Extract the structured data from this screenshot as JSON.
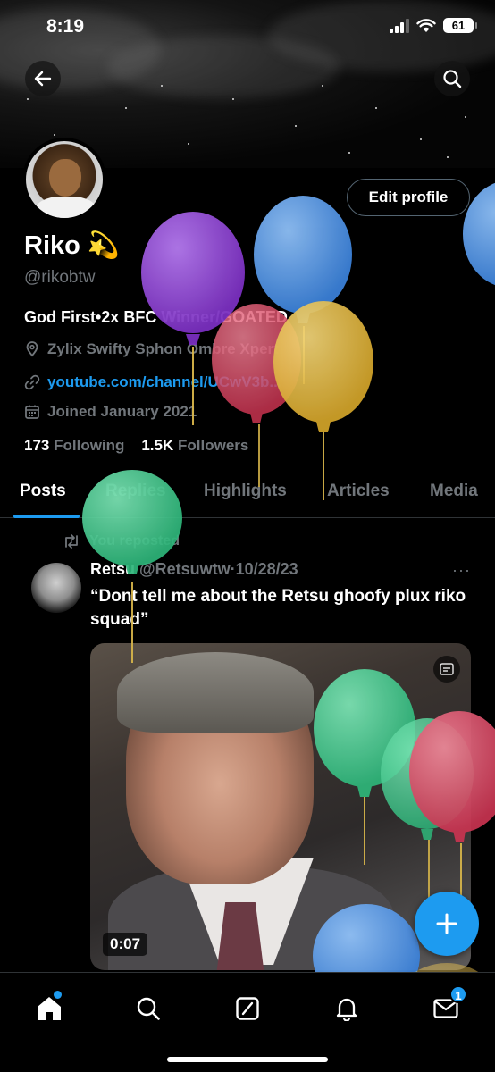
{
  "status_bar": {
    "time": "8:19",
    "battery": "61"
  },
  "header": {
    "back_icon": "arrow-left-icon",
    "search_icon": "search-icon"
  },
  "profile": {
    "name": "Riko",
    "emoji": "💫",
    "handle": "@rikobtw",
    "edit_label": "Edit profile",
    "bio": "God First•2x BFC Winner/GOATED",
    "location": "Zylix Swifty Sphon Ombre Xpert",
    "website": "youtube.com/channel/UCwV3b...",
    "joined": "Joined January 2021",
    "following_count": "173",
    "following_label": "Following",
    "followers_count": "1.5K",
    "followers_label": "Followers"
  },
  "tabs": [
    {
      "label": "Posts",
      "active": true
    },
    {
      "label": "Replies",
      "active": false
    },
    {
      "label": "Highlights",
      "active": false
    },
    {
      "label": "Articles",
      "active": false
    },
    {
      "label": "Media",
      "active": false
    }
  ],
  "post": {
    "repost_label": "You reposted",
    "author_name": "Retsu",
    "author_handle": "@Retsuwtw",
    "separator": "·",
    "date": "10/28/23",
    "more": "···",
    "text": "“Dont tell me about the Retsu ghoofy plux riko squad”",
    "video_duration": "0:07"
  },
  "nav": {
    "messages_badge": "1",
    "icons": [
      "home-icon",
      "search-icon",
      "compose-grok-icon",
      "notifications-bell-icon",
      "messages-envelope-icon"
    ]
  },
  "colors": {
    "accent": "#1d9bf0",
    "muted": "#71767b",
    "balloon_purple": "#8e3fcf",
    "balloon_blue": "#4a90e2",
    "balloon_red": "#d8435d",
    "balloon_yellow": "#e3b83a",
    "balloon_green": "#3fcf8e"
  }
}
